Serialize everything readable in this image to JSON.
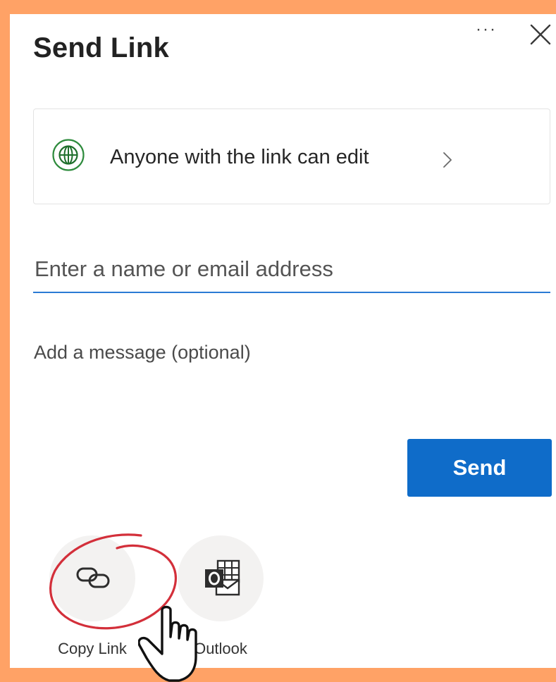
{
  "dialog": {
    "title": "Send Link",
    "more_label": "···"
  },
  "permission": {
    "text": "Anyone with the link can edit",
    "icon": "globe-icon",
    "icon_color": "#2E8B3D"
  },
  "recipient": {
    "placeholder": "Enter a name or email address",
    "value": ""
  },
  "message": {
    "placeholder": "Add a message (optional)",
    "value": ""
  },
  "send": {
    "label": "Send",
    "color": "#0F6CC9"
  },
  "share_options": [
    {
      "label": "Copy Link",
      "icon": "link-icon"
    },
    {
      "label": "Outlook",
      "icon": "outlook-icon"
    }
  ],
  "annotation": {
    "circle_color": "#D32F3A",
    "cursor": "hand-pointer-icon"
  },
  "colors": {
    "background": "#FFA266",
    "accent": "#2B7BD4"
  }
}
